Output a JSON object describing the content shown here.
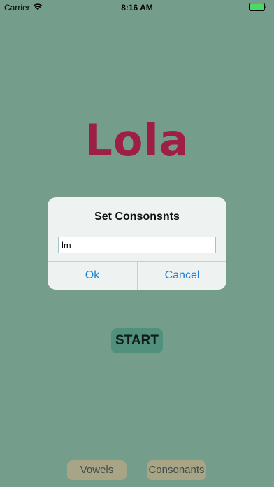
{
  "status_bar": {
    "carrier": "Carrier",
    "time": "8:16 AM",
    "wifi_icon": "wifi-icon",
    "battery_icon": "battery-icon"
  },
  "app": {
    "title": "Lola",
    "title_color": "#9d1f47",
    "background_color": "#749e8b"
  },
  "dialog": {
    "title": "Set Consonsnts",
    "input_value": "lm",
    "ok_label": "Ok",
    "cancel_label": "Cancel",
    "button_color": "#1f7fd0"
  },
  "main": {
    "start_label": "START"
  },
  "bottom": {
    "vowels_label": "Vowels",
    "consonants_label": "Consonants"
  }
}
